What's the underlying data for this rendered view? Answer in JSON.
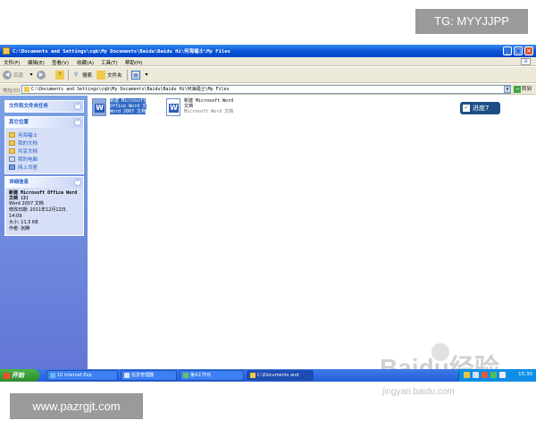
{
  "overlay": {
    "top_tag": "TG: MYYJJPP",
    "bottom_tag": "www.pazrgjt.com"
  },
  "window": {
    "title": "C:\\Documents and Settings\\cqb\\My Documents\\Baidu\\Baidu Hi\\何海福士\\My Files",
    "minimize": "_",
    "maximize": "□",
    "close": "×"
  },
  "menu": {
    "items": [
      "文件(F)",
      "编辑(E)",
      "查看(V)",
      "收藏(A)",
      "工具(T)",
      "帮助(H)"
    ]
  },
  "toolbar": {
    "back_label": "后退",
    "search_label": "搜索",
    "folders_label": "文件夹"
  },
  "address": {
    "label": "地址(D)",
    "value": "C:\\Documents and Settings\\cqb\\My Documents\\Baidu\\Baidu Hi\\何海福士\\My Files",
    "go_label": "转到"
  },
  "taskpane": {
    "file_tasks_title": "文件和文件夹任务",
    "other_places_title": "其它位置",
    "other_places": [
      "何海福士",
      "我的文档",
      "共享文档",
      "我的电脑",
      "网上邻居"
    ],
    "details_title": "详细信息",
    "details": {
      "name": "新建 Microsoft Office Word 文档 (2)",
      "type": "Word 2007 文档",
      "modified": "修改日期: 2011年12月12日, 14:09",
      "size": "大小: 11.5 KB",
      "author": "作者: 张腾"
    }
  },
  "files": [
    {
      "line1": "新建 Microsoft",
      "line2": "Office Word 文",
      "line3": "Word 2007 文档",
      "selected": true
    },
    {
      "line1": "新建 Microsoft Word",
      "line2": "文档",
      "line3": "Microsoft Word 文档",
      "selected": false
    }
  ],
  "float_button": {
    "label": "进度7"
  },
  "watermark": {
    "logo": "Baidu经验",
    "url": "jingyan.baidu.com"
  },
  "taskbar": {
    "start_label": "开始",
    "tasks": [
      "10 Internet Exp",
      "信息管理器",
      "第4工作日",
      "C:\\Documents and"
    ],
    "clock": "15:30"
  },
  "colors": {
    "titlebar": "#0a55d8",
    "taskpane": "#6375d6",
    "selection": "#316ac5",
    "start": "#2e8b2c"
  }
}
